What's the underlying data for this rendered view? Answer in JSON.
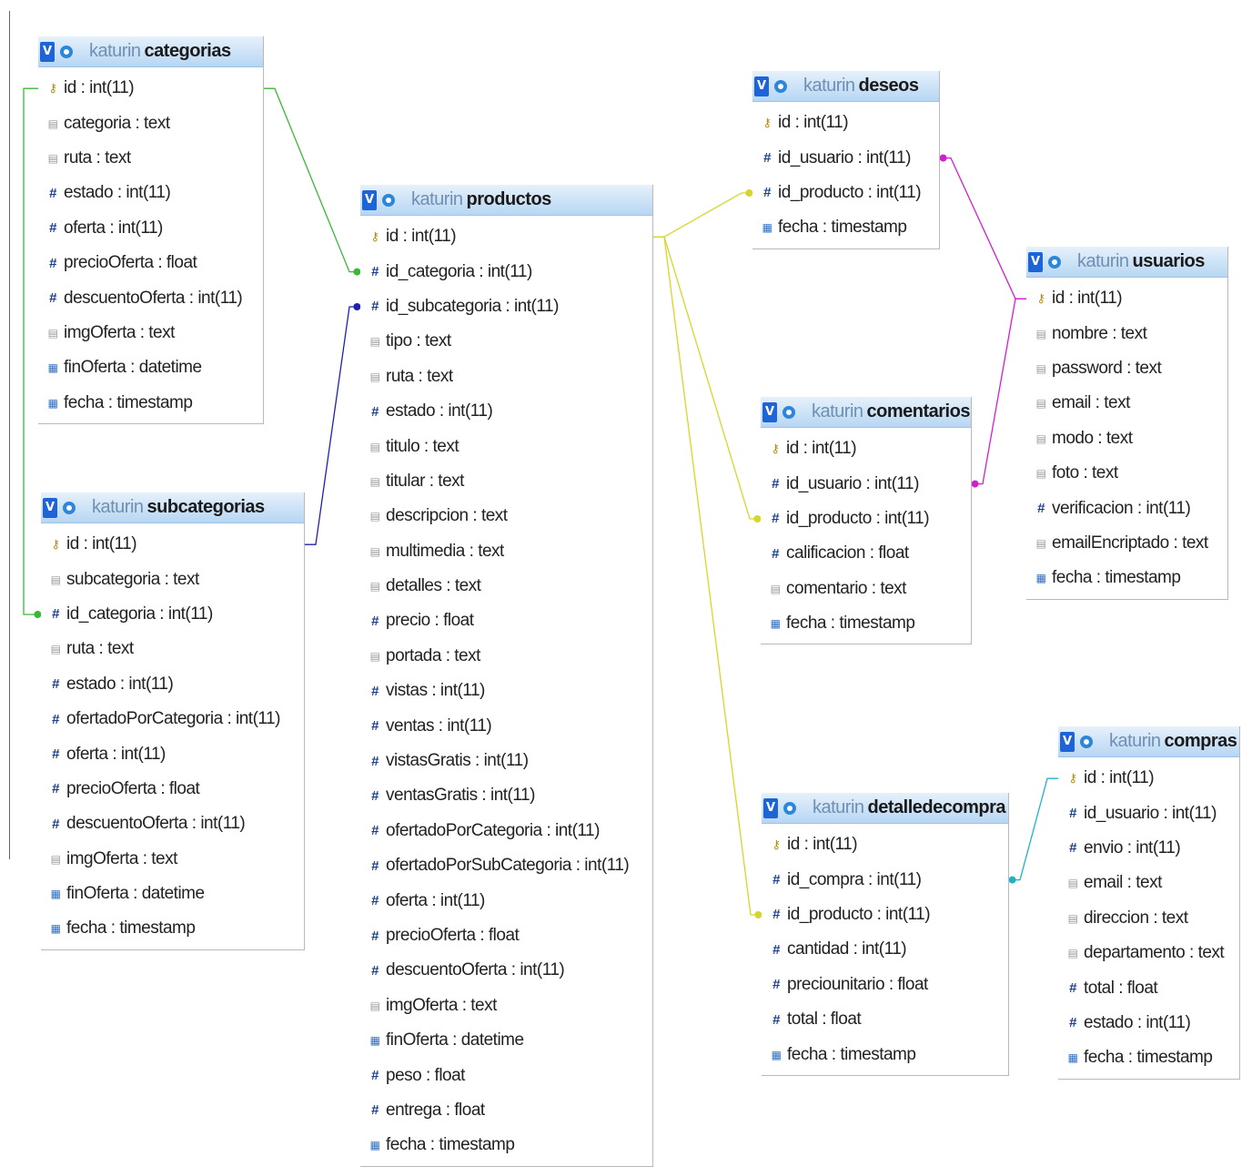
{
  "db": "katurin",
  "colors": {
    "categorias_link": "#38b838",
    "subcategorias_link": "#2020b0",
    "productos_link": "#d6d62a",
    "usuarios_link": "#d21ed2",
    "compras_link": "#1fb3c8"
  },
  "icons": {
    "toggle": "V",
    "key": "key-icon",
    "int": "hash-icon",
    "text": "text-icon",
    "date": "date-icon"
  },
  "tables": [
    {
      "id": "categorias",
      "db": "katurin",
      "name": "categorias",
      "columns": [
        {
          "text": "id : int(11)",
          "icon": "key"
        },
        {
          "text": "categoria : text",
          "icon": "text"
        },
        {
          "text": "ruta : text",
          "icon": "text"
        },
        {
          "text": "estado : int(11)",
          "icon": "int"
        },
        {
          "text": "oferta : int(11)",
          "icon": "int"
        },
        {
          "text": "precioOferta : float",
          "icon": "int"
        },
        {
          "text": "descuentoOferta : int(11)",
          "icon": "int"
        },
        {
          "text": "imgOferta : text",
          "icon": "text"
        },
        {
          "text": "finOferta : datetime",
          "icon": "date"
        },
        {
          "text": "fecha : timestamp",
          "icon": "date"
        }
      ]
    },
    {
      "id": "subcategorias",
      "db": "katurin",
      "name": "subcategorias",
      "columns": [
        {
          "text": "id : int(11)",
          "icon": "key"
        },
        {
          "text": "subcategoria : text",
          "icon": "text"
        },
        {
          "text": "id_categoria : int(11)",
          "icon": "int"
        },
        {
          "text": "ruta : text",
          "icon": "text"
        },
        {
          "text": "estado : int(11)",
          "icon": "int"
        },
        {
          "text": "ofertadoPorCategoria : int(11)",
          "icon": "int"
        },
        {
          "text": "oferta : int(11)",
          "icon": "int"
        },
        {
          "text": "precioOferta : float",
          "icon": "int"
        },
        {
          "text": "descuentoOferta : int(11)",
          "icon": "int"
        },
        {
          "text": "imgOferta : text",
          "icon": "text"
        },
        {
          "text": "finOferta : datetime",
          "icon": "date"
        },
        {
          "text": "fecha : timestamp",
          "icon": "date"
        }
      ]
    },
    {
      "id": "productos",
      "db": "katurin",
      "name": "productos",
      "columns": [
        {
          "text": "id : int(11)",
          "icon": "key"
        },
        {
          "text": "id_categoria : int(11)",
          "icon": "int"
        },
        {
          "text": "id_subcategoria : int(11)",
          "icon": "int"
        },
        {
          "text": "tipo : text",
          "icon": "text"
        },
        {
          "text": "ruta : text",
          "icon": "text"
        },
        {
          "text": "estado : int(11)",
          "icon": "int"
        },
        {
          "text": "titulo : text",
          "icon": "text"
        },
        {
          "text": "titular : text",
          "icon": "text"
        },
        {
          "text": "descripcion : text",
          "icon": "text"
        },
        {
          "text": "multimedia : text",
          "icon": "text"
        },
        {
          "text": "detalles : text",
          "icon": "text"
        },
        {
          "text": "precio : float",
          "icon": "int"
        },
        {
          "text": "portada : text",
          "icon": "text"
        },
        {
          "text": "vistas : int(11)",
          "icon": "int"
        },
        {
          "text": "ventas : int(11)",
          "icon": "int"
        },
        {
          "text": "vistasGratis : int(11)",
          "icon": "int"
        },
        {
          "text": "ventasGratis : int(11)",
          "icon": "int"
        },
        {
          "text": "ofertadoPorCategoria : int(11)",
          "icon": "int"
        },
        {
          "text": "ofertadoPorSubCategoria : int(11)",
          "icon": "int"
        },
        {
          "text": "oferta : int(11)",
          "icon": "int"
        },
        {
          "text": "precioOferta : float",
          "icon": "int"
        },
        {
          "text": "descuentoOferta : int(11)",
          "icon": "int"
        },
        {
          "text": "imgOferta : text",
          "icon": "text"
        },
        {
          "text": "finOferta : datetime",
          "icon": "date"
        },
        {
          "text": "peso : float",
          "icon": "int"
        },
        {
          "text": "entrega : float",
          "icon": "int"
        },
        {
          "text": "fecha : timestamp",
          "icon": "date"
        }
      ]
    },
    {
      "id": "deseos",
      "db": "katurin",
      "name": "deseos",
      "columns": [
        {
          "text": "id : int(11)",
          "icon": "key"
        },
        {
          "text": "id_usuario : int(11)",
          "icon": "int"
        },
        {
          "text": "id_producto : int(11)",
          "icon": "int"
        },
        {
          "text": "fecha : timestamp",
          "icon": "date"
        }
      ]
    },
    {
      "id": "comentarios",
      "db": "katurin",
      "name": "comentarios",
      "columns": [
        {
          "text": "id : int(11)",
          "icon": "key"
        },
        {
          "text": "id_usuario : int(11)",
          "icon": "int"
        },
        {
          "text": "id_producto : int(11)",
          "icon": "int"
        },
        {
          "text": "calificacion : float",
          "icon": "int"
        },
        {
          "text": "comentario : text",
          "icon": "text"
        },
        {
          "text": "fecha : timestamp",
          "icon": "date"
        }
      ]
    },
    {
      "id": "usuarios",
      "db": "katurin",
      "name": "usuarios",
      "columns": [
        {
          "text": "id : int(11)",
          "icon": "key"
        },
        {
          "text": "nombre : text",
          "icon": "text"
        },
        {
          "text": "password : text",
          "icon": "text"
        },
        {
          "text": "email : text",
          "icon": "text"
        },
        {
          "text": "modo : text",
          "icon": "text"
        },
        {
          "text": "foto : text",
          "icon": "text"
        },
        {
          "text": "verificacion : int(11)",
          "icon": "int"
        },
        {
          "text": "emailEncriptado : text",
          "icon": "text"
        },
        {
          "text": "fecha : timestamp",
          "icon": "date"
        }
      ]
    },
    {
      "id": "detalledecompra",
      "db": "katurin",
      "name": "detalledecompra",
      "columns": [
        {
          "text": "id : int(11)",
          "icon": "key"
        },
        {
          "text": "id_compra : int(11)",
          "icon": "int"
        },
        {
          "text": "id_producto : int(11)",
          "icon": "int"
        },
        {
          "text": "cantidad : int(11)",
          "icon": "int"
        },
        {
          "text": "preciounitario : float",
          "icon": "int"
        },
        {
          "text": "total : float",
          "icon": "int"
        },
        {
          "text": "fecha : timestamp",
          "icon": "date"
        }
      ]
    },
    {
      "id": "compras",
      "db": "katurin",
      "name": "compras",
      "columns": [
        {
          "text": "id : int(11)",
          "icon": "key"
        },
        {
          "text": "id_usuario : int(11)",
          "icon": "int"
        },
        {
          "text": "envio : int(11)",
          "icon": "int"
        },
        {
          "text": "email : text",
          "icon": "text"
        },
        {
          "text": "direccion : text",
          "icon": "text"
        },
        {
          "text": "departamento : text",
          "icon": "text"
        },
        {
          "text": "total : float",
          "icon": "int"
        },
        {
          "text": "estado : int(11)",
          "icon": "int"
        },
        {
          "text": "fecha : timestamp",
          "icon": "date"
        }
      ]
    }
  ],
  "relations": [
    {
      "from": "categorias.id",
      "to": "subcategorias.id_categoria",
      "color": "categorias_link"
    },
    {
      "from": "categorias.id",
      "to": "productos.id_categoria",
      "color": "categorias_link"
    },
    {
      "from": "subcategorias.id",
      "to": "productos.id_subcategoria",
      "color": "subcategorias_link"
    },
    {
      "from": "productos.id",
      "to": "deseos.id_producto",
      "color": "productos_link"
    },
    {
      "from": "productos.id",
      "to": "comentarios.id_producto",
      "color": "productos_link"
    },
    {
      "from": "productos.id",
      "to": "detalledecompra.id_producto",
      "color": "productos_link"
    },
    {
      "from": "usuarios.id",
      "to": "deseos.id_usuario",
      "color": "usuarios_link"
    },
    {
      "from": "usuarios.id",
      "to": "comentarios.id_usuario",
      "color": "usuarios_link"
    },
    {
      "from": "compras.id",
      "to": "detalledecompra.id_compra",
      "color": "compras_link"
    }
  ]
}
